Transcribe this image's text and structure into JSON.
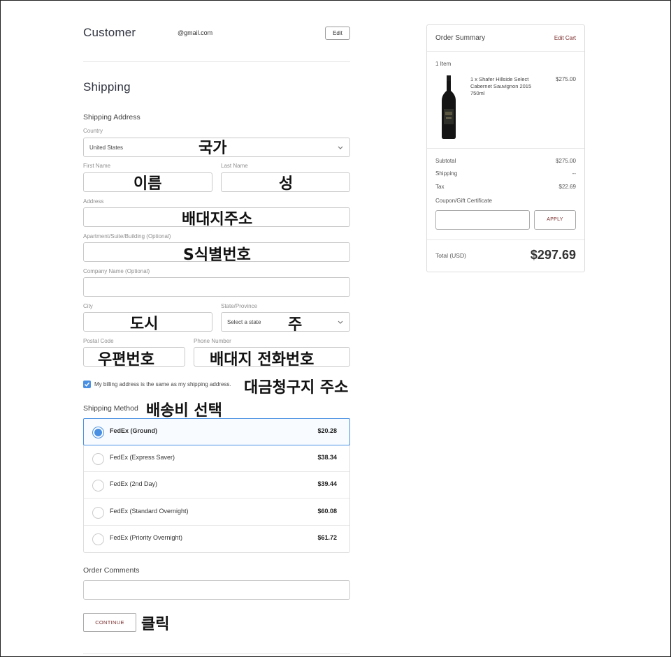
{
  "customer": {
    "title": "Customer",
    "email": "@gmail.com",
    "edit_label": "Edit"
  },
  "shipping": {
    "title": "Shipping",
    "address_heading": "Shipping Address",
    "fields": {
      "country_label": "Country",
      "country_value": "United States",
      "first_name_label": "First Name",
      "last_name_label": "Last Name",
      "address_label": "Address",
      "apartment_label": "Apartment/Suite/Building (Optional)",
      "company_label": "Company Name (Optional)",
      "city_label": "City",
      "state_label": "State/Province",
      "state_placeholder": "Select a state",
      "postal_label": "Postal Code",
      "phone_label": "Phone Number"
    },
    "billing_same_label": "My billing address is the same as my shipping address.",
    "billing_same_checked": true,
    "method_heading": "Shipping Method",
    "methods": [
      {
        "name": "FedEx (Ground)",
        "price": "$20.28",
        "selected": true
      },
      {
        "name": "FedEx (Express Saver)",
        "price": "$38.34",
        "selected": false
      },
      {
        "name": "FedEx (2nd Day)",
        "price": "$39.44",
        "selected": false
      },
      {
        "name": "FedEx (Standard Overnight)",
        "price": "$60.08",
        "selected": false
      },
      {
        "name": "FedEx (Priority Overnight)",
        "price": "$61.72",
        "selected": false
      }
    ],
    "comments_heading": "Order Comments",
    "continue_label": "CONTINUE"
  },
  "annotations": {
    "country": "국가",
    "first_name": "이름",
    "last_name": "성",
    "address": "배대지주소",
    "apartment": "S식별번호",
    "city": "도시",
    "state": "주",
    "postal": "우편번호",
    "phone": "배대지 전화번호",
    "billing": "대금청구지 주소",
    "method": "배송비 선택",
    "continue": "클릭"
  },
  "summary": {
    "title": "Order Summary",
    "edit_cart_label": "Edit Cart",
    "item_count": "1 Item",
    "item_desc": "1 x Shafer Hillside Select Cabernet Sauvignon 2015 750ml",
    "item_price": "$275.00",
    "subtotal_label": "Subtotal",
    "subtotal_value": "$275.00",
    "shipping_label": "Shipping",
    "shipping_value": "--",
    "tax_label": "Tax",
    "tax_value": "$22.69",
    "coupon_label": "Coupon/Gift Certificate",
    "apply_label": "APPLY",
    "total_label": "Total (USD)",
    "total_value": "$297.69"
  },
  "colors": {
    "accent": "#4a90e2",
    "link": "#7b2d2d",
    "text": "#313440"
  }
}
